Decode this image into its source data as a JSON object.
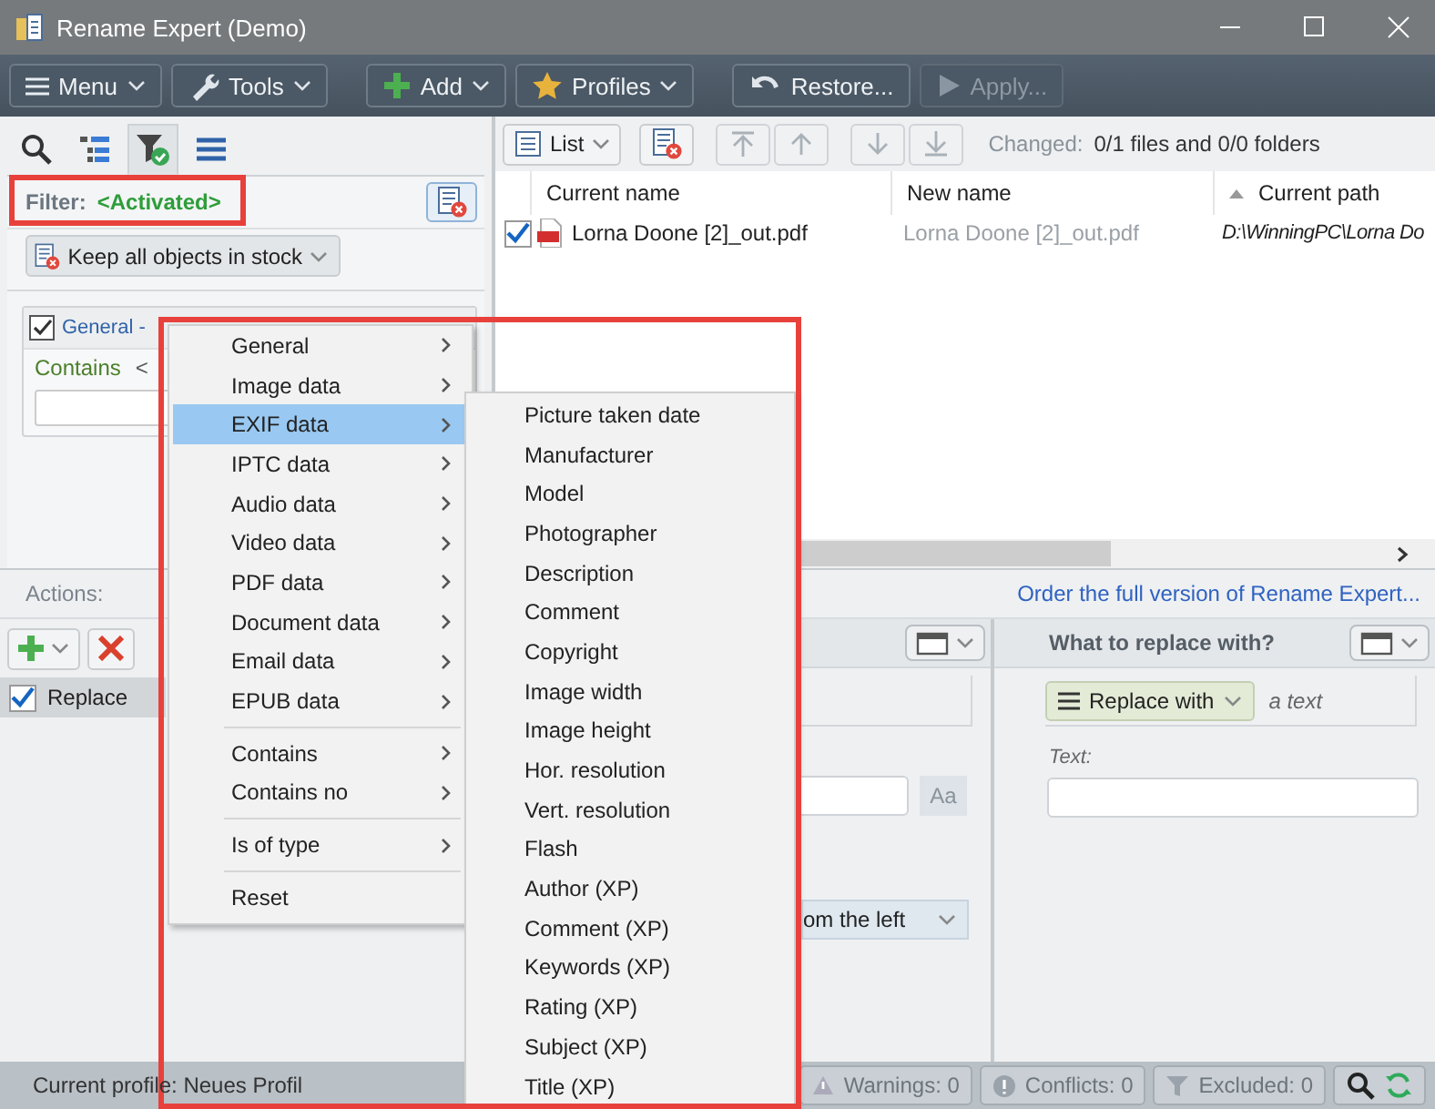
{
  "window": {
    "title": "Rename Expert (Demo)"
  },
  "toolbar": [
    {
      "label": "Menu",
      "dropdown": true,
      "disabled": false
    },
    {
      "label": "Tools",
      "dropdown": true,
      "disabled": false
    },
    {
      "label": "Add",
      "dropdown": true,
      "disabled": false
    },
    {
      "label": "Profiles",
      "dropdown": true,
      "disabled": false
    },
    {
      "label": "Restore...",
      "dropdown": false,
      "disabled": false
    },
    {
      "label": "Apply...",
      "dropdown": false,
      "disabled": true
    }
  ],
  "left_panel": {
    "tabs": [
      {
        "selected": false
      },
      {
        "selected": false
      },
      {
        "selected": true
      },
      {
        "selected": false
      }
    ],
    "filter": {
      "label": "Filter:",
      "value": "<Activated>"
    },
    "mode_dropdown": "Keep all objects in stock",
    "condition": {
      "checked": true,
      "title": "General -",
      "operator": "Contains",
      "value": "<"
    }
  },
  "file_list": {
    "view": "List",
    "changed_label": "Changed:",
    "changed_value": "0/1 files and 0/0 folders",
    "columns": [
      {
        "label": "Current name",
        "sorted": false
      },
      {
        "label": "New name",
        "sorted": false
      },
      {
        "label": "Current path",
        "sorted": true
      }
    ],
    "rows": [
      {
        "checked": true,
        "current_name": "Lorna Doone [2]_out.pdf",
        "new_name": "Lorna Doone [2]_out.pdf",
        "current_path": "D:\\WinningPC\\Lorna Do"
      }
    ]
  },
  "actions": {
    "label": "Actions:",
    "order_link": "Order the full version of Rename Expert...",
    "items": [
      {
        "label": "Replace",
        "checked": true,
        "selected": true
      }
    ]
  },
  "search_panel": {
    "case_button": "Aa",
    "dropdown": "om the left"
  },
  "replace_panel": {
    "title": "What to replace with?",
    "mode": "Replace with",
    "mode_hint": "a text",
    "text_label": "Text:"
  },
  "status_bar": {
    "profile": "Current profile: Neues Profil",
    "warnings": "Warnings: 0",
    "conflicts": "Conflicts: 0",
    "excluded": "Excluded: 0"
  },
  "context_menu": {
    "items": [
      {
        "kind": "item",
        "label": "General",
        "submenu": true,
        "selected": false
      },
      {
        "kind": "item",
        "label": "Image data",
        "submenu": true,
        "selected": false
      },
      {
        "kind": "item",
        "label": "EXIF data",
        "submenu": true,
        "selected": true
      },
      {
        "kind": "item",
        "label": "IPTC data",
        "submenu": true,
        "selected": false
      },
      {
        "kind": "item",
        "label": "Audio data",
        "submenu": true,
        "selected": false
      },
      {
        "kind": "item",
        "label": "Video data",
        "submenu": true,
        "selected": false
      },
      {
        "kind": "item",
        "label": "PDF data",
        "submenu": true,
        "selected": false
      },
      {
        "kind": "item",
        "label": "Document data",
        "submenu": true,
        "selected": false
      },
      {
        "kind": "item",
        "label": "Email data",
        "submenu": true,
        "selected": false
      },
      {
        "kind": "item",
        "label": "EPUB data",
        "submenu": true,
        "selected": false
      },
      {
        "kind": "separator"
      },
      {
        "kind": "item",
        "label": "Contains",
        "submenu": true,
        "selected": false
      },
      {
        "kind": "item",
        "label": "Contains no",
        "submenu": true,
        "selected": false
      },
      {
        "kind": "separator"
      },
      {
        "kind": "item",
        "label": "Is of type",
        "submenu": true,
        "selected": false
      },
      {
        "kind": "separator"
      },
      {
        "kind": "item",
        "label": "Reset",
        "submenu": false,
        "selected": false
      }
    ]
  },
  "submenu": {
    "items": [
      "Picture taken date",
      "Manufacturer",
      "Model",
      "Photographer",
      "Description",
      "Comment",
      "Copyright",
      "Image width",
      "Image height",
      "Hor. resolution",
      "Vert. resolution",
      "Flash",
      "Author (XP)",
      "Comment (XP)",
      "Keywords (XP)",
      "Rating (XP)",
      "Subject (XP)",
      "Title (XP)"
    ]
  },
  "highlights": [
    {
      "kind": "frame"
    },
    {
      "kind": "frame"
    }
  ]
}
